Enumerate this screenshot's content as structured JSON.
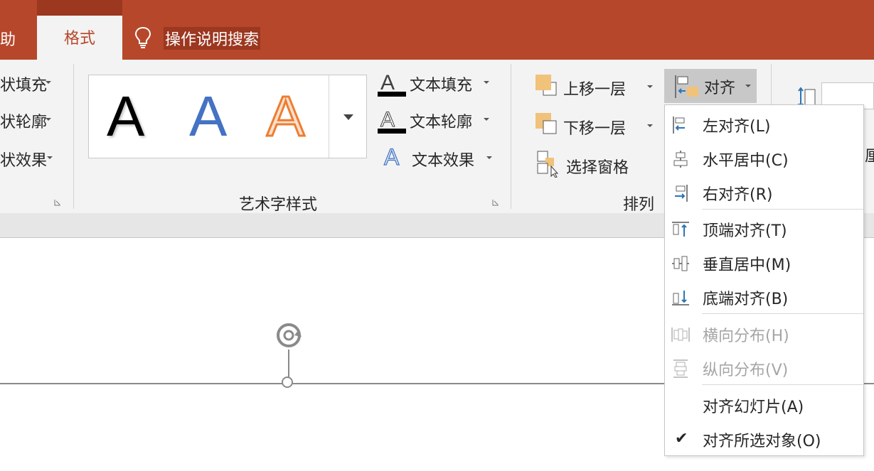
{
  "tabs": {
    "partial_left": "助",
    "active": "格式"
  },
  "tell_me": {
    "label": "操作说明搜索",
    "icon": "lightbulb-icon"
  },
  "shape_styles_partial": {
    "fill": "状填充",
    "outline": "状轮廓",
    "effects": "状效果"
  },
  "wordart": {
    "group_label": "艺术字样式",
    "gallery_glyph": "A",
    "text_fill": "文本填充",
    "text_outline": "文本轮廓",
    "text_effects": "文本效果"
  },
  "arrange": {
    "group_label": "排列",
    "bring_forward": "上移一层",
    "send_backward": "下移一层",
    "selection_pane": "选择窗格",
    "align": "对齐"
  },
  "size_partial": {
    "label": "厘"
  },
  "align_menu": {
    "items": [
      {
        "label": "左对齐(L)",
        "icon": "align-left-icon",
        "disabled": false
      },
      {
        "label": "水平居中(C)",
        "icon": "align-center-icon",
        "disabled": false
      },
      {
        "label": "右对齐(R)",
        "icon": "align-right-icon",
        "disabled": false
      },
      {
        "label": "顶端对齐(T)",
        "icon": "align-top-icon",
        "disabled": false
      },
      {
        "label": "垂直居中(M)",
        "icon": "align-middle-icon",
        "disabled": false
      },
      {
        "label": "底端对齐(B)",
        "icon": "align-bottom-icon",
        "disabled": false
      },
      {
        "label": "横向分布(H)",
        "icon": "distribute-horizontal-icon",
        "disabled": true
      },
      {
        "label": "纵向分布(V)",
        "icon": "distribute-vertical-icon",
        "disabled": true
      },
      {
        "label": "对齐幻灯片(A)",
        "icon": "",
        "disabled": false
      },
      {
        "label": "对齐所选对象(O)",
        "icon": "checkmark-icon",
        "checked": true,
        "disabled": false
      }
    ]
  },
  "colors": {
    "accent": "#b7472a",
    "accent_dark": "#9c3720",
    "ribbon_bg": "#f3f3f3",
    "icon_blue": "#2e75b6",
    "icon_orange": "#f0c27a"
  }
}
